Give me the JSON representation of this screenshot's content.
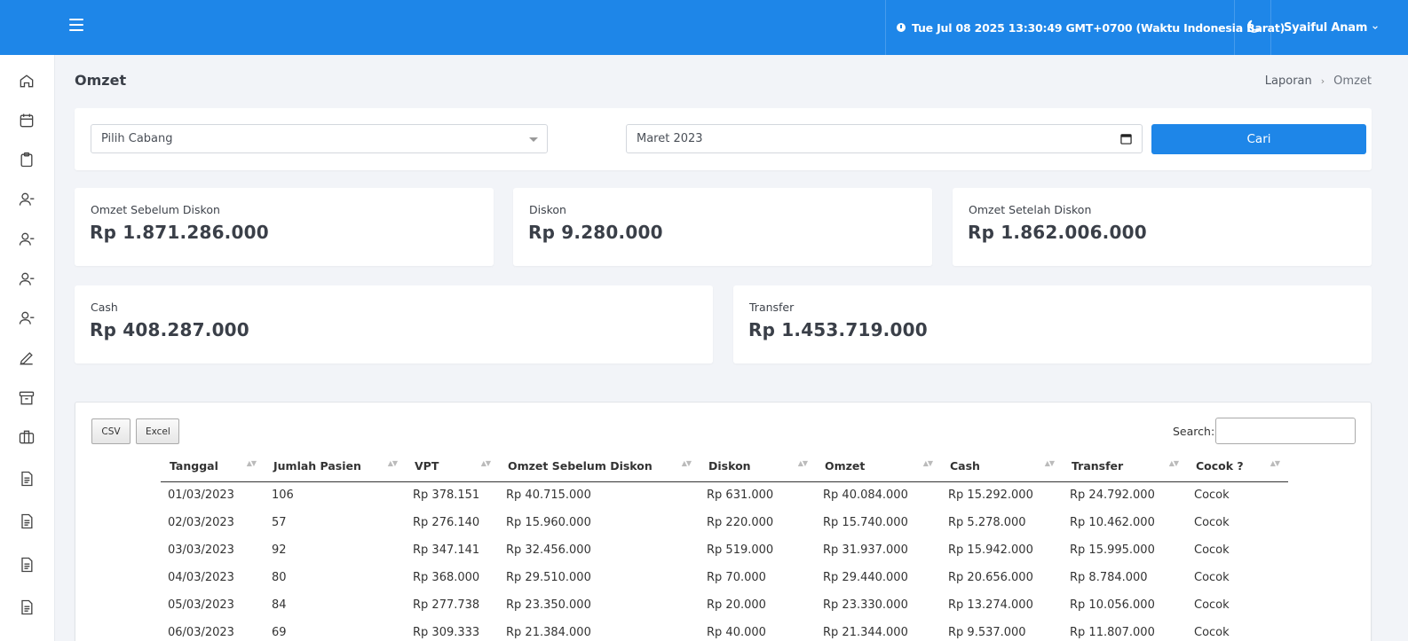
{
  "topbar": {
    "datetime": "Tue Jul 08 2025 13:30:49 GMT+0700 (Waktu Indonesia Barat)",
    "user_name": "Syaiful Anam",
    "colors": {
      "primary": "#1e86e8"
    }
  },
  "sidebar": {
    "icons": [
      "home-icon",
      "calendar-icon",
      "clipboard-icon",
      "user-minus-icon",
      "user-minus-icon",
      "user-minus-icon",
      "user-minus-icon",
      "pencil-icon",
      "archive-icon",
      "briefcase-icon",
      "document-icon",
      "document-icon",
      "document-icon",
      "document-icon"
    ]
  },
  "header": {
    "title": "Omzet",
    "breadcrumb": [
      "Laporan",
      "Omzet"
    ]
  },
  "filters": {
    "branch_placeholder": "Pilih Cabang",
    "month_value": "Maret 2023",
    "search_button": "Cari"
  },
  "stats": {
    "omzet_sebelum_diskon": {
      "label": "Omzet Sebelum Diskon",
      "value": "Rp 1.871.286.000"
    },
    "diskon": {
      "label": "Diskon",
      "value": "Rp 9.280.000"
    },
    "omzet_setelah_diskon": {
      "label": "Omzet Setelah Diskon",
      "value": "Rp 1.862.006.000"
    },
    "cash": {
      "label": "Cash",
      "value": "Rp 408.287.000"
    },
    "transfer": {
      "label": "Transfer",
      "value": "Rp 1.453.719.000"
    }
  },
  "table": {
    "buttons": {
      "csv": "CSV",
      "excel": "Excel"
    },
    "search_label": "Search:",
    "columns": [
      "Tanggal",
      "Jumlah Pasien",
      "VPT",
      "Omzet Sebelum Diskon",
      "Diskon",
      "Omzet",
      "Cash",
      "Transfer",
      "Cocok ?"
    ],
    "rows": [
      [
        "01/03/2023",
        "106",
        "Rp 378.151",
        "Rp 40.715.000",
        "Rp 631.000",
        "Rp 40.084.000",
        "Rp 15.292.000",
        "Rp 24.792.000",
        "Cocok"
      ],
      [
        "02/03/2023",
        "57",
        "Rp 276.140",
        "Rp 15.960.000",
        "Rp 220.000",
        "Rp 15.740.000",
        "Rp 5.278.000",
        "Rp 10.462.000",
        "Cocok"
      ],
      [
        "03/03/2023",
        "92",
        "Rp 347.141",
        "Rp 32.456.000",
        "Rp 519.000",
        "Rp 31.937.000",
        "Rp 15.942.000",
        "Rp 15.995.000",
        "Cocok"
      ],
      [
        "04/03/2023",
        "80",
        "Rp 368.000",
        "Rp 29.510.000",
        "Rp 70.000",
        "Rp 29.440.000",
        "Rp 20.656.000",
        "Rp 8.784.000",
        "Cocok"
      ],
      [
        "05/03/2023",
        "84",
        "Rp 277.738",
        "Rp 23.350.000",
        "Rp 20.000",
        "Rp 23.330.000",
        "Rp 13.274.000",
        "Rp 10.056.000",
        "Cocok"
      ],
      [
        "06/03/2023",
        "69",
        "Rp 309.333",
        "Rp 21.384.000",
        "Rp 40.000",
        "Rp 21.344.000",
        "Rp 9.537.000",
        "Rp 11.807.000",
        "Cocok"
      ]
    ]
  }
}
